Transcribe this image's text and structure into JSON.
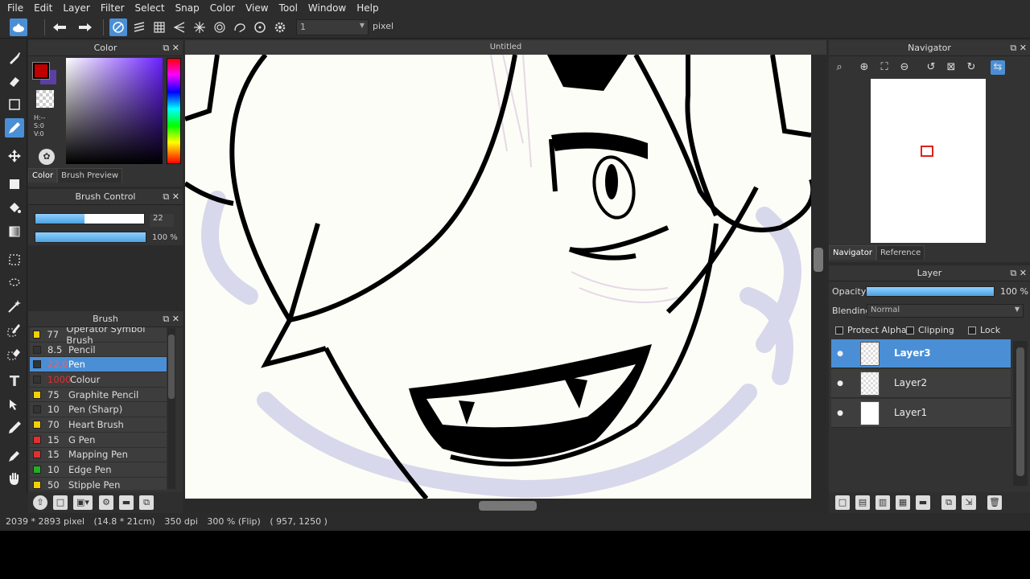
{
  "menu": [
    "File",
    "Edit",
    "Layer",
    "Filter",
    "Select",
    "Snap",
    "Color",
    "View",
    "Tool",
    "Window",
    "Help"
  ],
  "toolbar": {
    "brush_size_value": "1",
    "unit": "pixel",
    "icons": [
      "app-icon",
      "undo-icon",
      "redo-icon",
      "snap-off-icon",
      "parallel-snap-icon",
      "grid-snap-icon",
      "perspective-snap-icon",
      "radial-snap-icon",
      "concentric-snap-icon",
      "curve-snap-icon",
      "circle-snap-icon",
      "settings-icon"
    ]
  },
  "tools": [
    "brush-icon",
    "eraser-icon",
    "shape-icon",
    "pen-icon",
    "move-icon",
    "fill-rect-icon",
    "bucket-icon",
    "gradient-icon",
    "select-rect-icon",
    "lasso-icon",
    "magic-wand-icon",
    "select-pen-icon",
    "select-eraser-icon",
    "text-icon",
    "operation-icon",
    "eyedropper-icon",
    "pen-eyedropper-icon",
    "hand-icon"
  ],
  "color_panel": {
    "title": "Color",
    "hsv": [
      "H:--",
      "S:0",
      "V:0"
    ],
    "tabs": [
      "Color",
      "Brush Preview"
    ],
    "foreground": "#c00000",
    "background": "#5b3fa3"
  },
  "brush_control": {
    "title": "Brush Control",
    "size": "22",
    "opacity": "100 %",
    "size_fill": 0.45,
    "opacity_fill": 1.0
  },
  "brush_panel": {
    "title": "Brush",
    "items": [
      {
        "size": "77",
        "name": "Operator Symbol Brush",
        "color": "#f5d000",
        "selected": false
      },
      {
        "size": "8.5",
        "name": "Pencil",
        "color": "#333333",
        "selected": false
      },
      {
        "size": "22.0",
        "name": "Pen",
        "color": "#333333",
        "selected": true
      },
      {
        "size": "1000",
        "name": "Colour",
        "color": "#333333",
        "selected": false
      },
      {
        "size": "75",
        "name": "Graphite Pencil",
        "color": "#f5d000",
        "selected": false
      },
      {
        "size": "10",
        "name": "Pen (Sharp)",
        "color": "#333333",
        "selected": false
      },
      {
        "size": "70",
        "name": "Heart Brush",
        "color": "#f5d000",
        "selected": false
      },
      {
        "size": "15",
        "name": "G Pen",
        "color": "#e03030",
        "selected": false
      },
      {
        "size": "15",
        "name": "Mapping Pen",
        "color": "#e03030",
        "selected": false
      },
      {
        "size": "10",
        "name": "Edge Pen",
        "color": "#20b020",
        "selected": false
      },
      {
        "size": "50",
        "name": "Stipple Pen",
        "color": "#f5d000",
        "selected": false
      }
    ]
  },
  "document": {
    "title": "Untitled"
  },
  "status": {
    "size": "2039 * 2893 pixel",
    "physical": "(14.8 * 21cm)",
    "dpi": "350 dpi",
    "zoom": "300 % (Flip)",
    "cursor": "( 957, 1250 )"
  },
  "navigator": {
    "title": "Navigator",
    "tabs": [
      "Navigator",
      "Reference"
    ]
  },
  "layer_panel": {
    "title": "Layer",
    "opacity_label": "Opacity",
    "opacity_value": "100 %",
    "blending_label": "Blending",
    "blending_value": "Normal",
    "protect_alpha": "Protect Alpha",
    "clipping": "Clipping",
    "lock": "Lock",
    "layers": [
      {
        "name": "Layer3",
        "selected": true,
        "thumb": "transparent"
      },
      {
        "name": "Layer2",
        "selected": false,
        "thumb": "transparent"
      },
      {
        "name": "Layer1",
        "selected": false,
        "thumb": "white"
      }
    ]
  }
}
